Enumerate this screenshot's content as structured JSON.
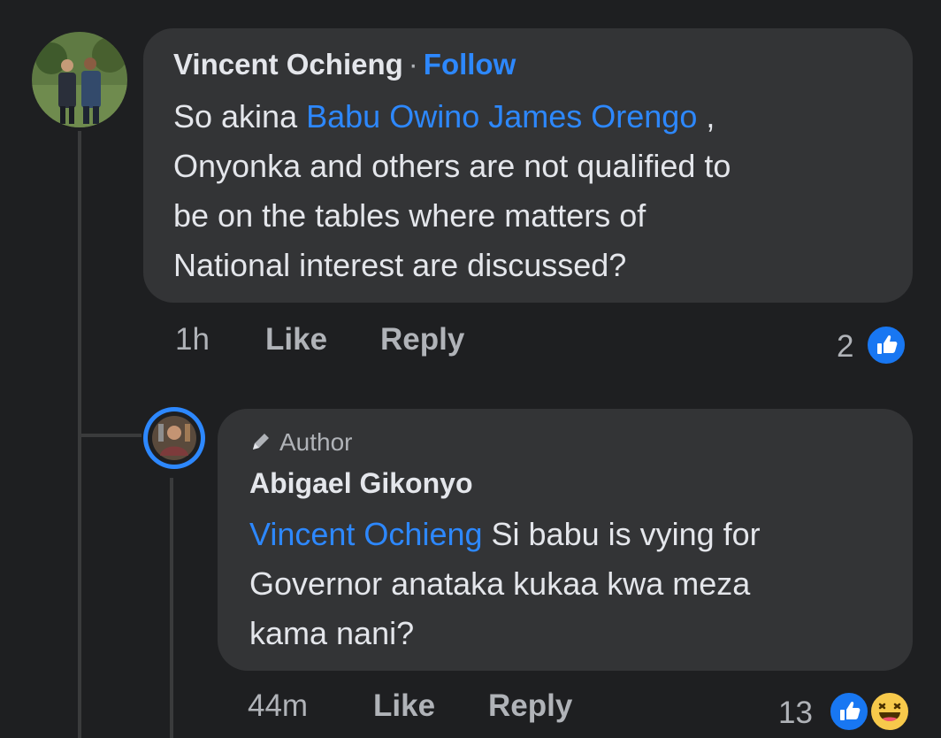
{
  "comment": {
    "author": "Vincent Ochieng",
    "separator": "·",
    "follow_label": "Follow",
    "text_prefix": "So akina ",
    "mention": "Babu Owino James Orengo",
    "text_line1_end": " ,",
    "text_line2": "Onyonka and others are not qualified to",
    "text_line3": "be on the tables where matters of",
    "text_line4": "National interest are discussed?",
    "time": "1h",
    "like_label": "Like",
    "reply_label": "Reply",
    "reaction_count": "2",
    "reaction_icons": [
      "like-icon"
    ]
  },
  "reply": {
    "author_badge_label": "Author",
    "author_badge_icon": "pencil-icon",
    "author": "Abigael Gikonyo",
    "mention": "Vincent Ochieng",
    "text_line1_rest": " Si babu is vying for",
    "text_line2": "Governor anataka kukaa kwa meza",
    "text_line3": "kama nani?",
    "time": "44m",
    "like_label": "Like",
    "reply_label": "Reply",
    "reaction_count": "13",
    "reaction_icons": [
      "like-icon",
      "haha-icon"
    ]
  },
  "colors": {
    "background": "#1e1f21",
    "bubble": "#333436",
    "mention": "#2d88ff",
    "secondary_text": "#b0b3b8",
    "primary_text": "#e4e6eb",
    "like_blue": "#1877f2",
    "avatar_ring": "#2d88ff"
  }
}
